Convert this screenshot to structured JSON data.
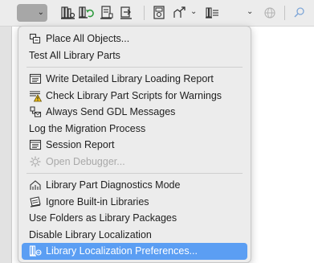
{
  "toolbar": {
    "icons": [
      "library-manager-icon",
      "reload-libraries-icon",
      "library-parts-icon",
      "migrate-libraries-icon",
      "object-settings-icon",
      "export-arrow-icon",
      "libraries-list-icon",
      "globe-icon",
      "search-icon"
    ]
  },
  "menu": {
    "items": [
      {
        "label": "Place All Objects...",
        "icon": "place-objects-icon",
        "enabled": true
      },
      {
        "label": "Test All Library Parts",
        "icon": "",
        "enabled": true
      },
      {
        "label": "Write Detailed Library Loading Report",
        "icon": "report-window-icon",
        "enabled": true
      },
      {
        "label": "Check Library Part Scripts for Warnings",
        "icon": "warning-list-icon",
        "enabled": true
      },
      {
        "label": "Always Send GDL Messages",
        "icon": "gdl-messages-icon",
        "enabled": true
      },
      {
        "label": "Log the Migration Process",
        "icon": "",
        "enabled": true
      },
      {
        "label": "Session Report",
        "icon": "session-report-icon",
        "enabled": true
      },
      {
        "label": "Open Debugger...",
        "icon": "debugger-gear-icon",
        "enabled": false
      },
      {
        "label": "Library Part Diagnostics Mode",
        "icon": "diagnostics-mode-icon",
        "enabled": true
      },
      {
        "label": "Ignore Built-in Libraries",
        "icon": "ignore-libraries-icon",
        "enabled": true
      },
      {
        "label": "Use Folders as Library Packages",
        "icon": "",
        "enabled": true
      },
      {
        "label": "Disable Library Localization",
        "icon": "",
        "enabled": true
      },
      {
        "label": "Library Localization Preferences...",
        "icon": "localization-preferences-icon",
        "enabled": true,
        "selected": true
      }
    ]
  },
  "colors": {
    "selection": "#5b9ef3",
    "menu_background": "#ececec",
    "disabled_text": "#a9a9a9",
    "close_button": "#ee5a52"
  }
}
